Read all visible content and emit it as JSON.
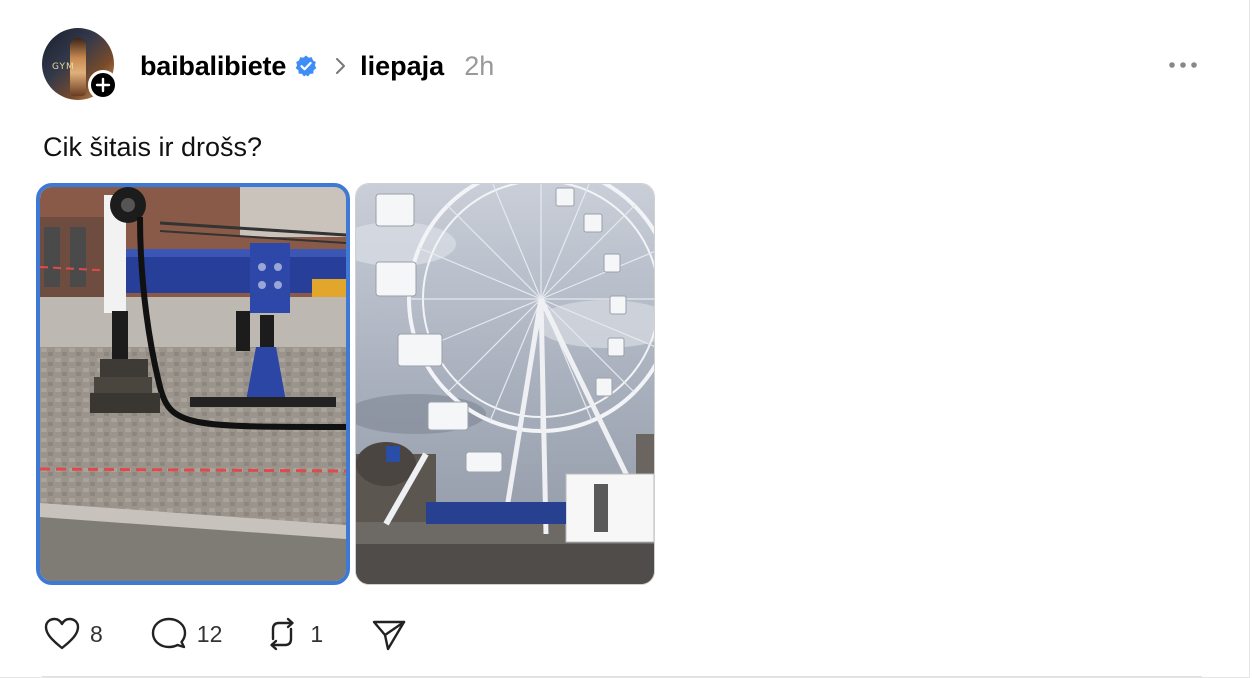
{
  "post": {
    "author": "baibalibiete",
    "community": "liepaja",
    "time": "2h",
    "text": "Cik šitais ir drošs?",
    "avatar_sign": "GYM",
    "verified_color": "#3f8ef5",
    "selection_color": "#3f79d6"
  },
  "icons": {
    "verified": "verified-badge-icon",
    "separator": "chevron-right-icon",
    "more": "more-dots-icon",
    "follow": "plus-icon",
    "like": "heart-icon",
    "reply": "comment-icon",
    "repost": "repost-icon",
    "share": "send-icon"
  },
  "actions": {
    "likes": "8",
    "replies": "12",
    "reposts": "1"
  }
}
